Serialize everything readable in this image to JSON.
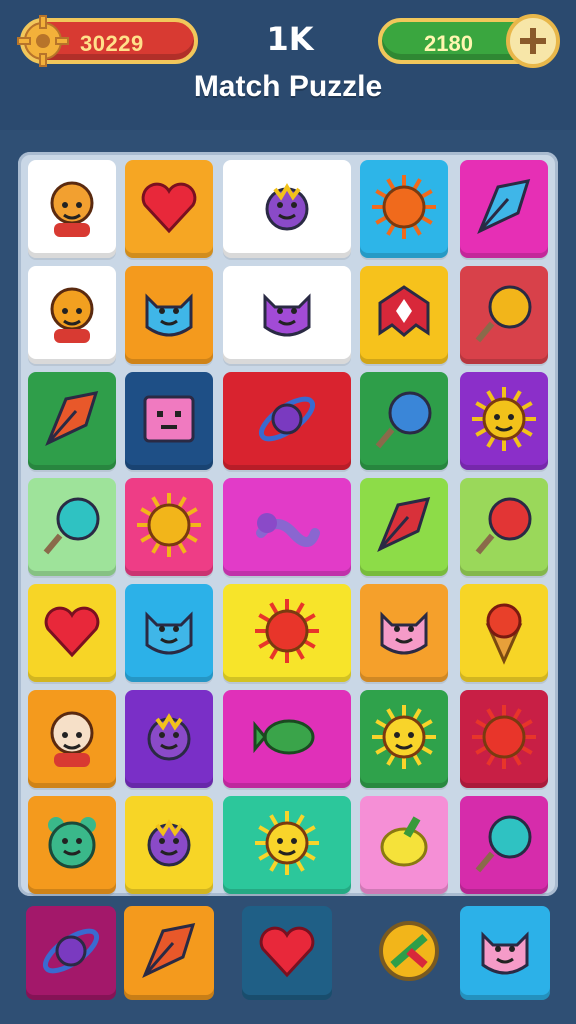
{
  "header": {
    "coins_value": "30229",
    "logo_text": "1K",
    "gems_value": "2180",
    "title": "Match Puzzle"
  },
  "board": {
    "rows": [
      [
        {
          "icon": "child-face-icon",
          "bg": "#ffffff"
        },
        {
          "icon": "heart-icon",
          "bg": "#f6a623"
        },
        {
          "icon": "purple-bear-icon",
          "bg": "#ffffff"
        },
        {
          "icon": "sun-icon",
          "bg": "#2db5e8"
        },
        {
          "icon": "shuttlecock-icon",
          "bg": "#e62fb5"
        }
      ],
      [
        {
          "icon": "fruit-face-icon",
          "bg": "#ffffff"
        },
        {
          "icon": "blue-cat-icon",
          "bg": "#f49a1d"
        },
        {
          "icon": "purple-cat-icon",
          "bg": "#ffffff"
        },
        {
          "icon": "crown-gem-icon",
          "bg": "#f6c21c"
        },
        {
          "icon": "lollipop-icon",
          "bg": "#d8414a"
        }
      ],
      [
        {
          "icon": "leaf-shard-icon",
          "bg": "#2f9e4a"
        },
        {
          "icon": "robot-block-icon",
          "bg": "#1e4f86"
        },
        {
          "icon": "planet-ring-icon",
          "bg": "#d9232f"
        },
        {
          "icon": "magnifier-icon",
          "bg": "#2e9e49"
        },
        {
          "icon": "gold-star-face-icon",
          "bg": "#8b2fc9"
        }
      ],
      [
        {
          "icon": "teal-pin-icon",
          "bg": "#9ee39a"
        },
        {
          "icon": "sunflower-icon",
          "bg": "#ee3d86"
        },
        {
          "icon": "worm-icon",
          "bg": "#e23bc8"
        },
        {
          "icon": "red-leaf-icon",
          "bg": "#8ddc48"
        },
        {
          "icon": "red-pin-icon",
          "bg": "#9ad85a"
        }
      ],
      [
        {
          "icon": "heart-gem-icon",
          "bg": "#f7d526"
        },
        {
          "icon": "blue-cat-face-icon",
          "bg": "#2cb1e8"
        },
        {
          "icon": "red-sun-icon",
          "bg": "#f7e42a"
        },
        {
          "icon": "pink-cat-icon",
          "bg": "#f5a02b"
        },
        {
          "icon": "ice-cream-icon",
          "bg": "#f7d526"
        }
      ],
      [
        {
          "icon": "man-icon",
          "bg": "#f49a1d"
        },
        {
          "icon": "purple-imp-icon",
          "bg": "#7a2fc7"
        },
        {
          "icon": "green-fish-icon",
          "bg": "#e030b9"
        },
        {
          "icon": "yellow-sun-face-icon",
          "bg": "#2fa24b"
        },
        {
          "icon": "red-flower-icon",
          "bg": "#c81f45"
        }
      ],
      [
        {
          "icon": "green-bear-icon",
          "bg": "#f49a1d"
        },
        {
          "icon": "purple-bird-icon",
          "bg": "#f7d526"
        },
        {
          "icon": "yellow-star-face-icon",
          "bg": "#2cc79b"
        },
        {
          "icon": "lemon-icon",
          "bg": "#f58fd6"
        },
        {
          "icon": "teal-racket-icon",
          "bg": "#d62cab"
        }
      ]
    ]
  },
  "tray": [
    {
      "icon": "planet-ring-icon",
      "bg": "#a3186a"
    },
    {
      "icon": "leaf-shard-icon",
      "bg": "#f49a1d"
    },
    {
      "icon": "heart-icon",
      "bg": "#1f5f86"
    },
    {
      "icon": "compass-icon",
      "bg": "transparent"
    },
    {
      "icon": "pink-cat-icon",
      "bg": "#2cb1e8"
    }
  ]
}
